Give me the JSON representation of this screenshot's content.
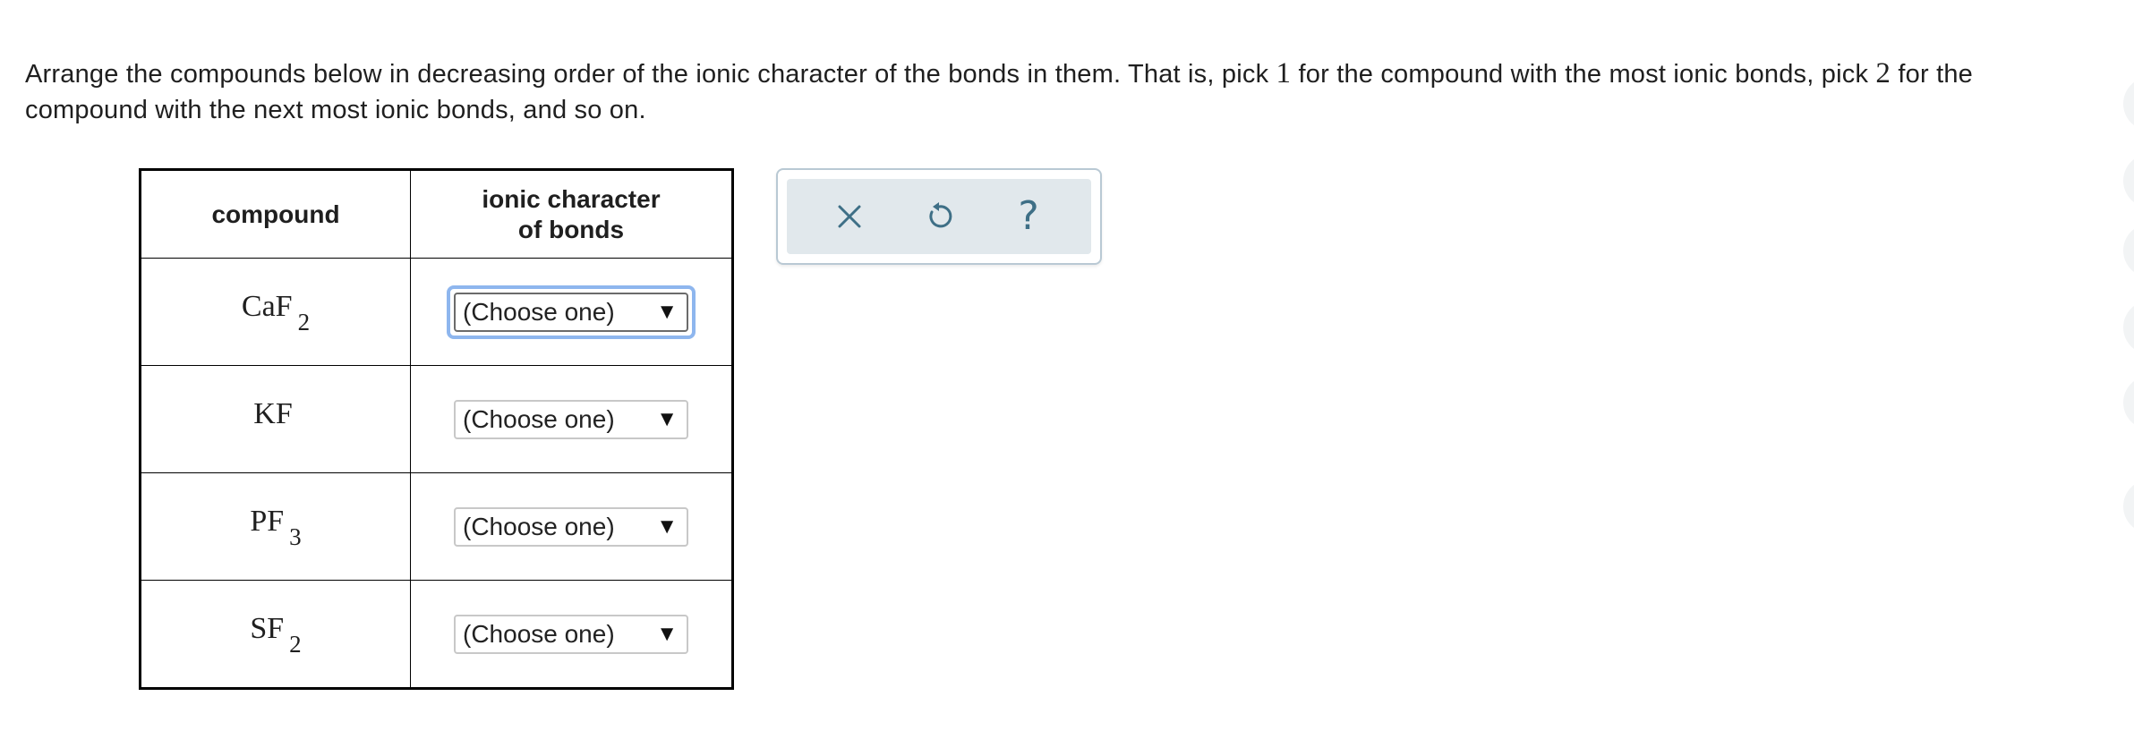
{
  "question": {
    "text_part1": "Arrange the compounds below in decreasing order of the ionic character of the bonds in them. That is, pick ",
    "num1": "1",
    "text_part2": " for the compound with the most ionic bonds, pick ",
    "num2": "2",
    "text_part3": " for the compound with the next most ionic bonds, and so on."
  },
  "table": {
    "header_compound": "compound",
    "header_ionic_line1": "ionic character",
    "header_ionic_line2": "of bonds",
    "rows": [
      {
        "formula": "CaF",
        "subscript": "2",
        "selection": "(Choose one)"
      },
      {
        "formula": "KF",
        "subscript": "",
        "selection": "(Choose one)"
      },
      {
        "formula": "PF",
        "subscript": "3",
        "selection": "(Choose one)"
      },
      {
        "formula": "SF",
        "subscript": "2",
        "selection": "(Choose one)"
      }
    ],
    "dropdown_arrow": "▼"
  },
  "toolbar": {
    "icons": [
      "close-icon",
      "undo-icon",
      "help-icon"
    ],
    "help_glyph": "?"
  },
  "colors": {
    "toolbar_bg": "#e1e8ec",
    "toolbar_icon": "#3e6f86",
    "focus_ring": "#8eb6ee"
  }
}
